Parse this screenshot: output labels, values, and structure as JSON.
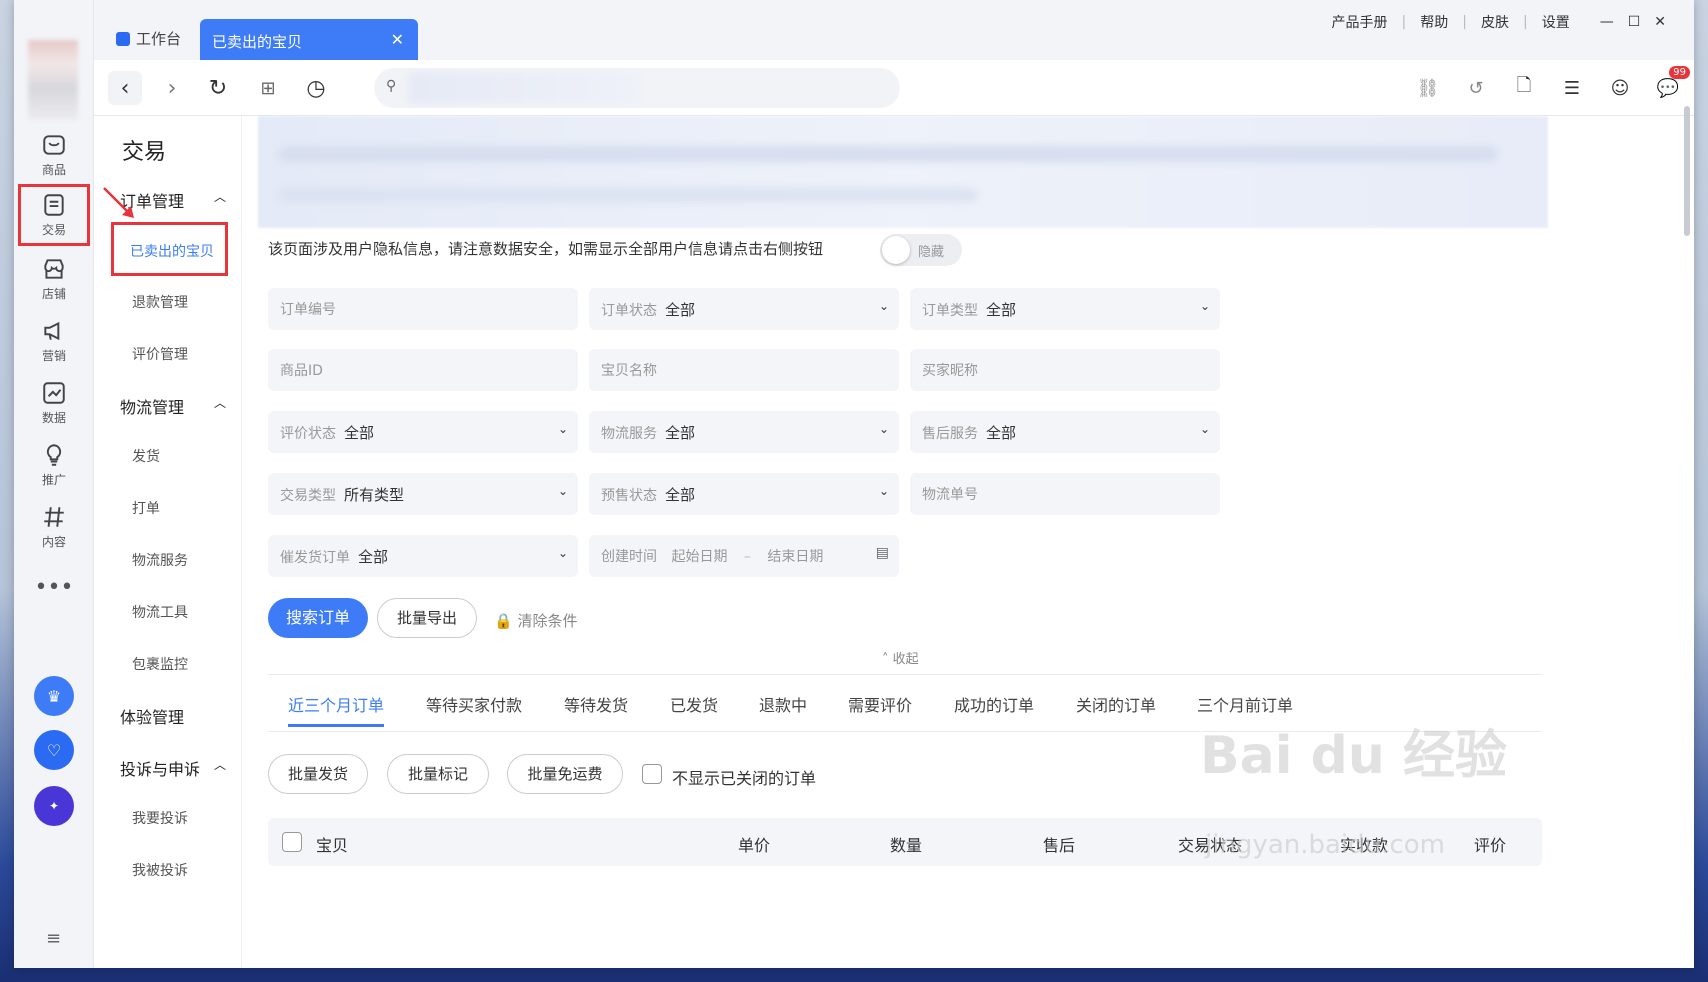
{
  "colors": {
    "accent": "#3d7cf6",
    "highlight": "#e8343b"
  },
  "left_nav": [
    {
      "label": "商品",
      "icon": "bag-icon"
    },
    {
      "label": "交易",
      "icon": "order-icon",
      "highlighted": true
    },
    {
      "label": "店铺",
      "icon": "store-icon"
    },
    {
      "label": "营销",
      "icon": "megaphone-icon"
    },
    {
      "label": "数据",
      "icon": "chart-icon"
    },
    {
      "label": "推广",
      "icon": "bulb-icon"
    },
    {
      "label": "内容",
      "icon": "hash-icon"
    }
  ],
  "tabs": {
    "workbench": "工作台",
    "active": "已卖出的宝贝"
  },
  "top_links": {
    "manual": "产品手册",
    "help": "帮助",
    "skin": "皮肤",
    "settings": "设置"
  },
  "badge_count": "99",
  "sidebar": {
    "title": "交易",
    "groups": {
      "order": {
        "label": "订单管理",
        "items": [
          "已卖出的宝贝",
          "退款管理",
          "评价管理"
        ]
      },
      "logistics": {
        "label": "物流管理",
        "items": [
          "发货",
          "打单",
          "物流服务",
          "物流工具",
          "包裹监控"
        ]
      },
      "experience": {
        "label": "体验管理"
      },
      "complaint": {
        "label": "投诉与申诉",
        "items": [
          "我要投诉",
          "我被投诉"
        ]
      }
    }
  },
  "privacy": {
    "text": "该页面涉及用户隐私信息，请注意数据安全，如需显示全部用户信息请点击右侧按钮",
    "toggle": "隐藏"
  },
  "filters": {
    "order_no": "订单编号",
    "order_status": {
      "label": "订单状态",
      "value": "全部"
    },
    "order_type": {
      "label": "订单类型",
      "value": "全部"
    },
    "product_id": "商品ID",
    "item_name": "宝贝名称",
    "buyer_nick": "买家昵称",
    "review_status": {
      "label": "评价状态",
      "value": "全部"
    },
    "logistics_service": {
      "label": "物流服务",
      "value": "全部"
    },
    "aftersale": {
      "label": "售后服务",
      "value": "全部"
    },
    "trade_type": {
      "label": "交易类型",
      "value": "所有类型"
    },
    "presale": {
      "label": "预售状态",
      "value": "全部"
    },
    "tracking_no": "物流单号",
    "urge": {
      "label": "催发货订单",
      "value": "全部"
    },
    "created": {
      "label": "创建时间",
      "start": "起始日期",
      "sep": "–",
      "end": "结束日期"
    }
  },
  "actions": {
    "search": "搜索订单",
    "export": "批量导出",
    "clear": "清除条件",
    "collapse": "收起"
  },
  "order_tabs": [
    "近三个月订单",
    "等待买家付款",
    "等待发货",
    "已发货",
    "退款中",
    "需要评价",
    "成功的订单",
    "关闭的订单",
    "三个月前订单"
  ],
  "bulk": {
    "ship": "批量发货",
    "mark": "批量标记",
    "free": "批量免运费",
    "hide_closed": "不显示已关闭的订单"
  },
  "table_headers": [
    "宝贝",
    "单价",
    "数量",
    "售后",
    "交易状态",
    "实收款",
    "评价"
  ],
  "watermark": {
    "brand": "Bai du 经验",
    "url": "jingyan.baidu.com"
  }
}
